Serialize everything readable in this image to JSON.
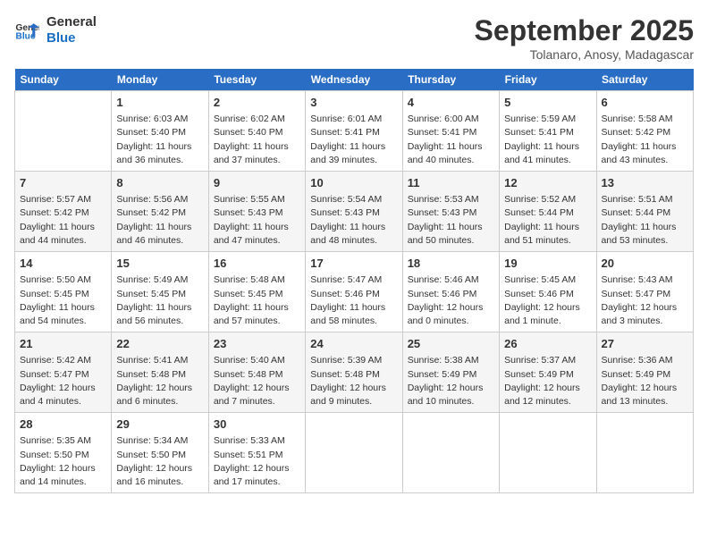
{
  "header": {
    "logo_line1": "General",
    "logo_line2": "Blue",
    "month_year": "September 2025",
    "location": "Tolanaro, Anosy, Madagascar"
  },
  "days_of_week": [
    "Sunday",
    "Monday",
    "Tuesday",
    "Wednesday",
    "Thursday",
    "Friday",
    "Saturday"
  ],
  "weeks": [
    [
      {
        "day": "",
        "info": ""
      },
      {
        "day": "1",
        "info": "Sunrise: 6:03 AM\nSunset: 5:40 PM\nDaylight: 11 hours\nand 36 minutes."
      },
      {
        "day": "2",
        "info": "Sunrise: 6:02 AM\nSunset: 5:40 PM\nDaylight: 11 hours\nand 37 minutes."
      },
      {
        "day": "3",
        "info": "Sunrise: 6:01 AM\nSunset: 5:41 PM\nDaylight: 11 hours\nand 39 minutes."
      },
      {
        "day": "4",
        "info": "Sunrise: 6:00 AM\nSunset: 5:41 PM\nDaylight: 11 hours\nand 40 minutes."
      },
      {
        "day": "5",
        "info": "Sunrise: 5:59 AM\nSunset: 5:41 PM\nDaylight: 11 hours\nand 41 minutes."
      },
      {
        "day": "6",
        "info": "Sunrise: 5:58 AM\nSunset: 5:42 PM\nDaylight: 11 hours\nand 43 minutes."
      }
    ],
    [
      {
        "day": "7",
        "info": "Sunrise: 5:57 AM\nSunset: 5:42 PM\nDaylight: 11 hours\nand 44 minutes."
      },
      {
        "day": "8",
        "info": "Sunrise: 5:56 AM\nSunset: 5:42 PM\nDaylight: 11 hours\nand 46 minutes."
      },
      {
        "day": "9",
        "info": "Sunrise: 5:55 AM\nSunset: 5:43 PM\nDaylight: 11 hours\nand 47 minutes."
      },
      {
        "day": "10",
        "info": "Sunrise: 5:54 AM\nSunset: 5:43 PM\nDaylight: 11 hours\nand 48 minutes."
      },
      {
        "day": "11",
        "info": "Sunrise: 5:53 AM\nSunset: 5:43 PM\nDaylight: 11 hours\nand 50 minutes."
      },
      {
        "day": "12",
        "info": "Sunrise: 5:52 AM\nSunset: 5:44 PM\nDaylight: 11 hours\nand 51 minutes."
      },
      {
        "day": "13",
        "info": "Sunrise: 5:51 AM\nSunset: 5:44 PM\nDaylight: 11 hours\nand 53 minutes."
      }
    ],
    [
      {
        "day": "14",
        "info": "Sunrise: 5:50 AM\nSunset: 5:45 PM\nDaylight: 11 hours\nand 54 minutes."
      },
      {
        "day": "15",
        "info": "Sunrise: 5:49 AM\nSunset: 5:45 PM\nDaylight: 11 hours\nand 56 minutes."
      },
      {
        "day": "16",
        "info": "Sunrise: 5:48 AM\nSunset: 5:45 PM\nDaylight: 11 hours\nand 57 minutes."
      },
      {
        "day": "17",
        "info": "Sunrise: 5:47 AM\nSunset: 5:46 PM\nDaylight: 11 hours\nand 58 minutes."
      },
      {
        "day": "18",
        "info": "Sunrise: 5:46 AM\nSunset: 5:46 PM\nDaylight: 12 hours\nand 0 minutes."
      },
      {
        "day": "19",
        "info": "Sunrise: 5:45 AM\nSunset: 5:46 PM\nDaylight: 12 hours\nand 1 minute."
      },
      {
        "day": "20",
        "info": "Sunrise: 5:43 AM\nSunset: 5:47 PM\nDaylight: 12 hours\nand 3 minutes."
      }
    ],
    [
      {
        "day": "21",
        "info": "Sunrise: 5:42 AM\nSunset: 5:47 PM\nDaylight: 12 hours\nand 4 minutes."
      },
      {
        "day": "22",
        "info": "Sunrise: 5:41 AM\nSunset: 5:48 PM\nDaylight: 12 hours\nand 6 minutes."
      },
      {
        "day": "23",
        "info": "Sunrise: 5:40 AM\nSunset: 5:48 PM\nDaylight: 12 hours\nand 7 minutes."
      },
      {
        "day": "24",
        "info": "Sunrise: 5:39 AM\nSunset: 5:48 PM\nDaylight: 12 hours\nand 9 minutes."
      },
      {
        "day": "25",
        "info": "Sunrise: 5:38 AM\nSunset: 5:49 PM\nDaylight: 12 hours\nand 10 minutes."
      },
      {
        "day": "26",
        "info": "Sunrise: 5:37 AM\nSunset: 5:49 PM\nDaylight: 12 hours\nand 12 minutes."
      },
      {
        "day": "27",
        "info": "Sunrise: 5:36 AM\nSunset: 5:49 PM\nDaylight: 12 hours\nand 13 minutes."
      }
    ],
    [
      {
        "day": "28",
        "info": "Sunrise: 5:35 AM\nSunset: 5:50 PM\nDaylight: 12 hours\nand 14 minutes."
      },
      {
        "day": "29",
        "info": "Sunrise: 5:34 AM\nSunset: 5:50 PM\nDaylight: 12 hours\nand 16 minutes."
      },
      {
        "day": "30",
        "info": "Sunrise: 5:33 AM\nSunset: 5:51 PM\nDaylight: 12 hours\nand 17 minutes."
      },
      {
        "day": "",
        "info": ""
      },
      {
        "day": "",
        "info": ""
      },
      {
        "day": "",
        "info": ""
      },
      {
        "day": "",
        "info": ""
      }
    ]
  ]
}
